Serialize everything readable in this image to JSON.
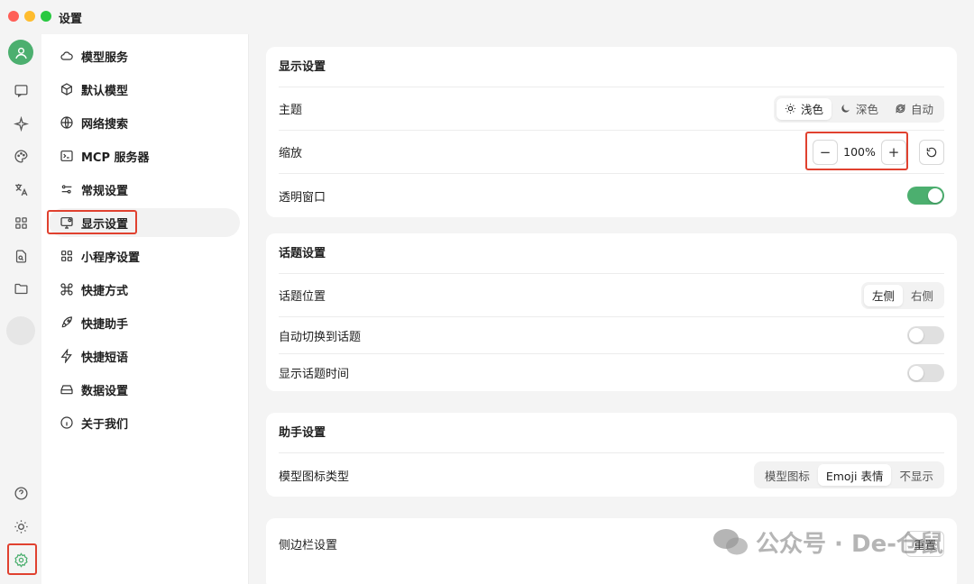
{
  "window": {
    "title": "设置"
  },
  "rail": {
    "icons": [
      "user-avatar-icon",
      "chat-icon",
      "sparkle-icon",
      "palette-icon",
      "translate-icon",
      "apps-grid-icon",
      "doc-search-icon",
      "folder-icon",
      "help-icon",
      "sun-icon",
      "settings-gear-icon"
    ],
    "accent": "#4caf6f"
  },
  "sidebar": {
    "items": [
      {
        "label": "模型服务",
        "icon": "cloud-icon"
      },
      {
        "label": "默认模型",
        "icon": "cube-icon"
      },
      {
        "label": "网络搜索",
        "icon": "globe-icon"
      },
      {
        "label": "MCP 服务器",
        "icon": "terminal-icon"
      },
      {
        "label": "常规设置",
        "icon": "sliders-icon"
      },
      {
        "label": "显示设置",
        "icon": "monitor-settings-icon"
      },
      {
        "label": "小程序设置",
        "icon": "apps-grid-icon"
      },
      {
        "label": "快捷方式",
        "icon": "command-icon"
      },
      {
        "label": "快捷助手",
        "icon": "rocket-icon"
      },
      {
        "label": "快捷短语",
        "icon": "bolt-icon"
      },
      {
        "label": "数据设置",
        "icon": "drive-icon"
      },
      {
        "label": "关于我们",
        "icon": "info-icon"
      }
    ],
    "active_index": 5
  },
  "display": {
    "title": "显示设置",
    "theme": {
      "label": "主题",
      "options": [
        "浅色",
        "深色",
        "自动"
      ],
      "selected": 0
    },
    "zoom": {
      "label": "缩放",
      "value": "100%",
      "minus": "−",
      "plus": "+"
    },
    "transparent": {
      "label": "透明窗口",
      "on": true
    }
  },
  "topic": {
    "title": "话题设置",
    "position": {
      "label": "话题位置",
      "options": [
        "左侧",
        "右侧"
      ],
      "selected": 0
    },
    "auto_switch": {
      "label": "自动切换到话题",
      "on": false
    },
    "show_time": {
      "label": "显示话题时间",
      "on": false
    }
  },
  "assistant": {
    "title": "助手设置",
    "icon_type": {
      "label": "模型图标类型",
      "options": [
        "模型图标",
        "Emoji 表情",
        "不显示"
      ],
      "selected": 1
    }
  },
  "sidebar_settings": {
    "title": "侧边栏设置",
    "reset": "重置"
  },
  "watermark": "公众号 · De-仓鼠",
  "colors": {
    "highlight": "#e0412f",
    "toggle_on": "#4caf6f"
  }
}
